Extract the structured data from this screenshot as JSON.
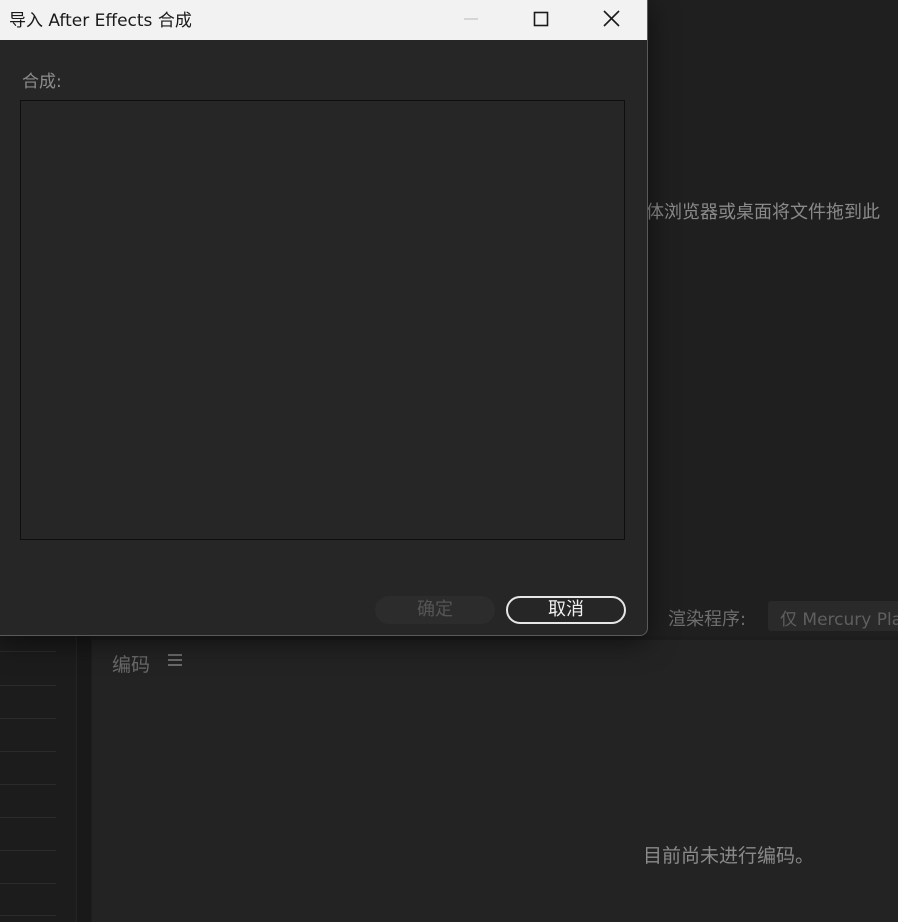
{
  "background": {
    "drop_hint": "体浏览器或桌面将文件拖到此",
    "renderer": {
      "label": "渲染程序:",
      "value": "仅 Mercury Playback Engine 软件"
    },
    "encode_panel": {
      "title": "编码",
      "menu_icon": "hamburger-menu-icon",
      "empty_message": "目前尚未进行编码。"
    }
  },
  "dialog": {
    "title": "导入 After Effects 合成",
    "window_controls": {
      "minimize": "minimize-icon",
      "maximize": "maximize-icon",
      "close": "close-icon"
    },
    "composition_label": "合成:",
    "composition_items": [],
    "buttons": {
      "ok": "确定",
      "cancel": "取消"
    }
  },
  "colors": {
    "dialog_bg": "#262626",
    "titlebar_bg": "#f2f2f2",
    "app_bg": "#1f1f1f",
    "disabled_text": "#555555",
    "cancel_border": "#e6e6e6"
  }
}
